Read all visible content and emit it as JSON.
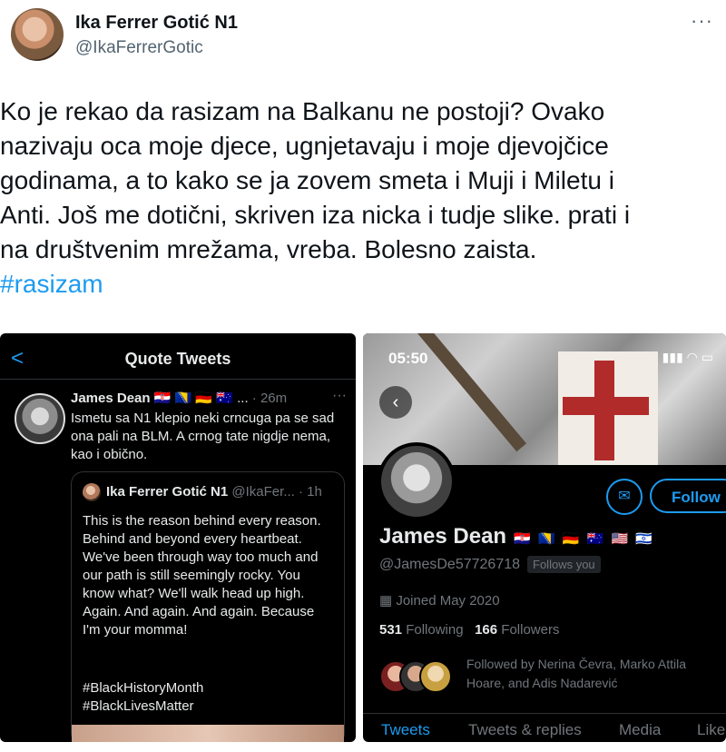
{
  "author": {
    "name": "Ika Ferrer Gotić N1",
    "handle": "@IkaFerrerGotic",
    "more": "···"
  },
  "tweet": {
    "lines": [
      "Ko je rekao da rasizam na Balkanu ne postoji? Ovako",
      "nazivaju oca moje djece, ugnjetavaju i moje djevojčice",
      "godinama, a to kako se ja zovem smeta i Muji i Miletu i",
      "Anti. Još me dotični, skriven iza nicka i tudje slike. prati i",
      "na društvenim mrežama, vreba. Bolesno zaista."
    ],
    "hashtag": "#rasizam"
  },
  "left_screenshot": {
    "back": "<",
    "title": "Quote Tweets",
    "reply": {
      "name": "James Dean",
      "flags": "🇭🇷 🇧🇦 🇩🇪 🇦🇺 ...",
      "time": "· 26m",
      "more": "···",
      "text": "Ismetu sa N1 klepio neki crncuga pa se sad ona pali na BLM. A crnog tate nigdje nema, kao i obično."
    },
    "quoted": {
      "name": "Ika Ferrer Gotić N1",
      "handle": "@IkaFer...",
      "time": "· 1h",
      "text": "This is the reason behind every reason. Behind and beyond every heartbeat. We've been through way too much and our path is still seemingly rocky. You know what? We'll walk head up high. Again. And again. And again. Because I'm your momma!",
      "tag1": "#BlackHistoryMonth",
      "tag2": "#BlackLivesMatter"
    }
  },
  "right_screenshot": {
    "status_time": "05:50",
    "status_icons": "▮▮▮ ◠ ▭",
    "back": "‹",
    "mail_icon": "✉",
    "follow_label": "Follow",
    "name": "James Dean",
    "flags": "🇭🇷 🇧🇦 🇩🇪 🇦🇺 🇺🇸 🇮🇱",
    "handle": "@JamesDe57726718",
    "follows_you": "Follows you",
    "joined": "Joined May 2020",
    "following_count": "531",
    "following_label": "Following",
    "followers_count": "166",
    "followers_label": "Followers",
    "followed_by": "Followed by Nerina Čevra, Marko Attila Hoare, and Adis Nadarević",
    "tabs": [
      "Tweets",
      "Tweets & replies",
      "Media",
      "Likes"
    ]
  },
  "colors": {
    "accent": "#1d9bf0",
    "text": "#0f1419",
    "muted": "#536471",
    "dark_bg": "#000000"
  }
}
